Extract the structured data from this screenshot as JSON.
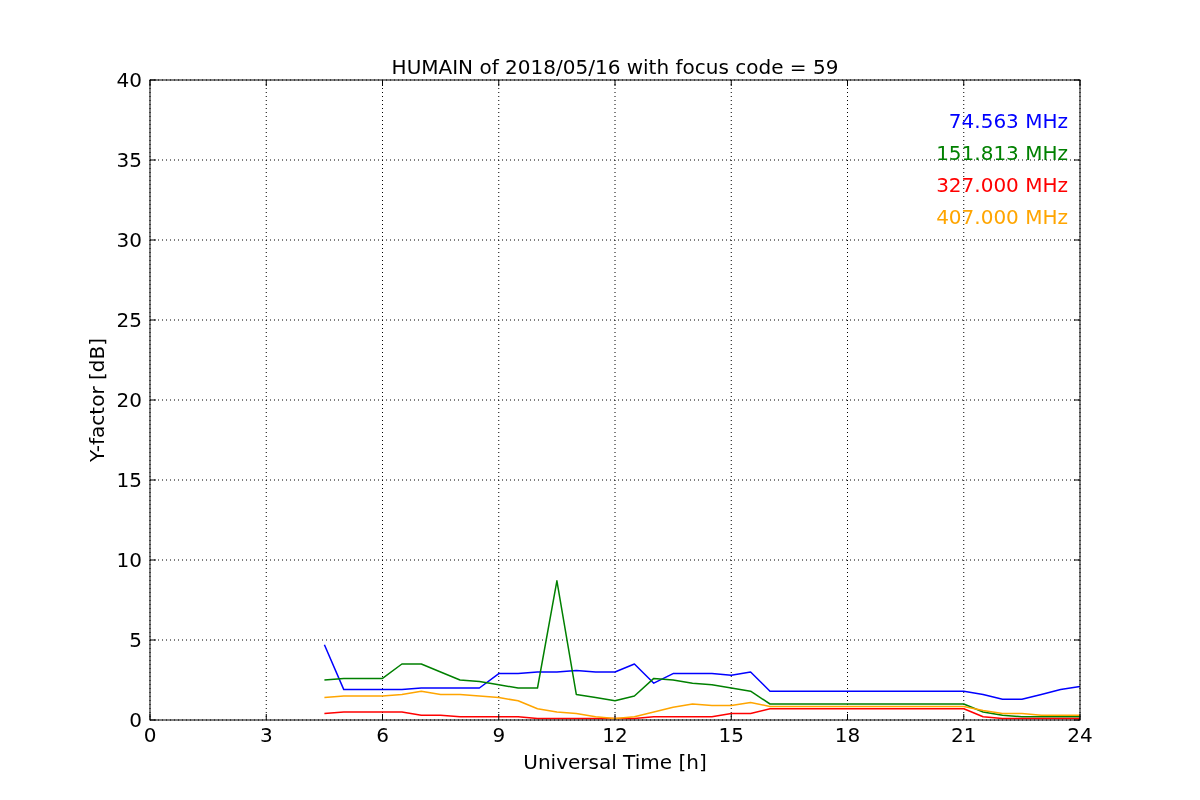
{
  "chart_data": {
    "type": "line",
    "title": "HUMAIN of 2018/05/16 with focus code = 59",
    "xlabel": "Universal Time [h]",
    "ylabel": "Y-factor [dB]",
    "x": [
      4.5,
      5,
      5.5,
      6,
      6.5,
      7,
      7.5,
      8,
      8.5,
      9,
      9.5,
      10,
      10.5,
      11,
      11.5,
      12,
      12.5,
      13,
      13.5,
      14,
      14.5,
      15,
      15.5,
      16,
      16.5,
      17,
      17.5,
      18,
      18.5,
      19,
      19.5,
      20,
      20.5,
      21,
      21.5,
      22,
      22.5,
      23,
      23.5,
      24
    ],
    "series": [
      {
        "name": "74.563 MHz",
        "color": "#0000ff",
        "values": [
          4.7,
          1.9,
          1.9,
          1.9,
          1.9,
          2.0,
          2.0,
          2.0,
          2.0,
          2.9,
          2.9,
          3.0,
          3.0,
          3.1,
          3.0,
          3.0,
          3.5,
          2.3,
          2.9,
          2.9,
          2.9,
          2.8,
          3.0,
          1.8,
          1.8,
          1.8,
          1.8,
          1.8,
          1.8,
          1.8,
          1.8,
          1.8,
          1.8,
          1.8,
          1.6,
          1.3,
          1.3,
          1.6,
          1.9,
          2.1
        ]
      },
      {
        "name": "151.813 MHz",
        "color": "#008000",
        "values": [
          2.5,
          2.6,
          2.6,
          2.6,
          3.5,
          3.5,
          3.0,
          2.5,
          2.4,
          2.2,
          2.0,
          2.0,
          8.7,
          1.6,
          1.4,
          1.2,
          1.5,
          2.6,
          2.5,
          2.3,
          2.2,
          2.0,
          1.8,
          1.0,
          1.0,
          1.0,
          1.0,
          1.0,
          1.0,
          1.0,
          1.0,
          1.0,
          1.0,
          1.0,
          0.5,
          0.3,
          0.2,
          0.2,
          0.2,
          0.2
        ]
      },
      {
        "name": "327.000 MHz",
        "color": "#ff0000",
        "values": [
          0.4,
          0.5,
          0.5,
          0.5,
          0.5,
          0.3,
          0.3,
          0.2,
          0.2,
          0.2,
          0.2,
          0.1,
          0.1,
          0.1,
          0.1,
          0.1,
          0.1,
          0.2,
          0.2,
          0.2,
          0.2,
          0.4,
          0.4,
          0.7,
          0.7,
          0.7,
          0.7,
          0.7,
          0.7,
          0.7,
          0.7,
          0.7,
          0.7,
          0.7,
          0.2,
          0.1,
          0.1,
          0.1,
          0.1,
          0.1
        ]
      },
      {
        "name": "407.000 MHz",
        "color": "#ffa500",
        "values": [
          1.4,
          1.5,
          1.5,
          1.5,
          1.6,
          1.8,
          1.6,
          1.6,
          1.5,
          1.4,
          1.2,
          0.7,
          0.5,
          0.4,
          0.2,
          0.1,
          0.2,
          0.5,
          0.8,
          1.0,
          0.9,
          0.9,
          1.1,
          0.85,
          0.85,
          0.85,
          0.85,
          0.85,
          0.85,
          0.85,
          0.85,
          0.85,
          0.85,
          0.85,
          0.6,
          0.4,
          0.4,
          0.3,
          0.3,
          0.3
        ]
      }
    ],
    "grid": true,
    "xlim": [
      0,
      24
    ],
    "ylim": [
      0,
      40
    ],
    "xticks": [
      0,
      3,
      6,
      9,
      12,
      15,
      18,
      21,
      24
    ],
    "yticks": [
      0,
      5,
      10,
      15,
      20,
      25,
      30,
      35,
      40
    ]
  }
}
